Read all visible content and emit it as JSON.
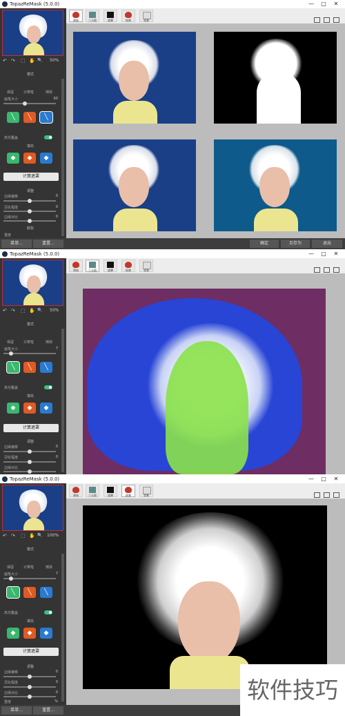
{
  "app_title": "TopazReMask (5.0.0)",
  "window_controls": {
    "minimize": "—",
    "maximize": "□",
    "close": "✕"
  },
  "tools": {
    "undo": "↶",
    "redo": "↷",
    "select": "⬚",
    "hand": "✋",
    "zoom": "🔍",
    "zoom_values": [
      "50%",
      "50%",
      "100%"
    ]
  },
  "panel": {
    "brush_section": "模式",
    "brush_labels": [
      "保留",
      "计算笔",
      "擦除"
    ],
    "brush_size_label": "画笔大小",
    "brush_size_values": [
      "60",
      "7",
      "7"
    ],
    "overlay_label": "高光覆盖",
    "fill_section": "填充",
    "compute_button": "计算遮罩",
    "adjust_section": "调整",
    "adjust_labels": [
      "边缘偏移",
      "羽化程度",
      "边缘对比"
    ],
    "adjust_values": [
      "0",
      "0",
      "0"
    ],
    "color_section": "颜色",
    "color_label": "重度",
    "color_value": "%"
  },
  "bottom": {
    "menu_button": "菜单...",
    "reset_button": "重置...",
    "ok_button": "确定",
    "saveas_button": "另存为",
    "exit_button": "退出"
  },
  "tabs": [
    "原始",
    "三元图",
    "遮罩",
    "结果",
    "背景"
  ],
  "colors": {
    "photo_blue": "#1a3f87",
    "result_blue": "#0d5a8b",
    "keep_green": "#3ab76f",
    "calc_orange": "#e05a24",
    "erase_blue": "#2a7ad1",
    "trimap_purple": "#6e2d63"
  },
  "watermark": "软件技巧"
}
